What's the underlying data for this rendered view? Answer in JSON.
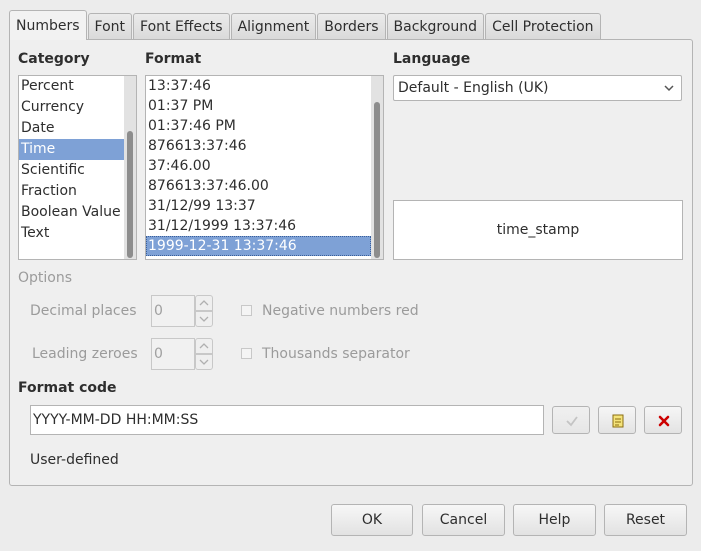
{
  "tabs": [
    {
      "label": "Numbers"
    },
    {
      "label": "Font"
    },
    {
      "label": "Font Effects"
    },
    {
      "label": "Alignment"
    },
    {
      "label": "Borders"
    },
    {
      "label": "Background"
    },
    {
      "label": "Cell Protection"
    }
  ],
  "active_tab": "Numbers",
  "category": {
    "heading": "Category",
    "items": [
      "Percent",
      "Currency",
      "Date",
      "Time",
      "Scientific",
      "Fraction",
      "Boolean Value",
      "Text"
    ],
    "selected": "Time"
  },
  "format": {
    "heading": "Format",
    "items": [
      "13:37:46",
      "01:37 PM",
      "01:37:46 PM",
      "876613:37:46",
      "37:46.00",
      "876613:37:46.00",
      "31/12/99 13:37",
      "31/12/1999 13:37:46",
      "1999-12-31 13:37:46"
    ],
    "selected": "1999-12-31 13:37:46"
  },
  "language": {
    "heading": "Language",
    "selected": "Default - English (UK)"
  },
  "preview": {
    "text": "time_stamp"
  },
  "options": {
    "heading": "Options",
    "decimal_places_label": "Decimal places",
    "decimal_places_value": "0",
    "leading_zeroes_label": "Leading zeroes",
    "leading_zeroes_value": "0",
    "negative_red_label": "Negative numbers red",
    "thousands_sep_label": "Thousands separator"
  },
  "format_code": {
    "heading": "Format code",
    "value": "YYYY-MM-DD HH:MM:SS",
    "status": "User-defined"
  },
  "buttons": {
    "ok": "OK",
    "cancel": "Cancel",
    "help": "Help",
    "reset": "Reset"
  },
  "colors": {
    "selection": "#7ea1d6",
    "delete_icon": "#cc0000"
  }
}
